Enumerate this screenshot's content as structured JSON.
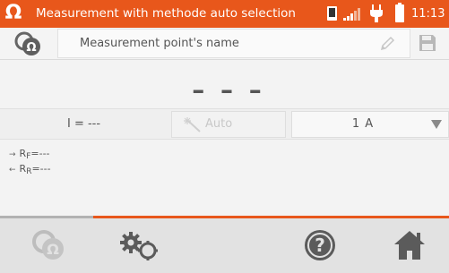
{
  "status_bar": {
    "omega_symbol": "Ω",
    "title": "Measurement with methode auto selection",
    "time": "11:13",
    "icons": [
      "omega-icon",
      "sd-card-icon",
      "signal-icon",
      "plug-icon",
      "battery-icon"
    ]
  },
  "point": {
    "name_placeholder": "Measurement point's name",
    "icons": [
      "measurement-icon",
      "pencil-icon",
      "save-icon"
    ]
  },
  "result": {
    "main_value": "– – –"
  },
  "params": {
    "current": "I = ---",
    "mode_label": "Auto",
    "range_value": "1 A"
  },
  "sub_results": {
    "forward_prefix": "R",
    "forward_sub": "F",
    "forward_value": "=---",
    "reverse_prefix": "R",
    "reverse_sub": "R",
    "reverse_value": "=---"
  },
  "toolbar": {
    "items": [
      "measurement-icon",
      "settings-gears-icon",
      "help-icon",
      "home-icon"
    ]
  },
  "colors": {
    "accent": "#e8571b",
    "background": "#f3f3f3",
    "toolbar": "#e2e2e2"
  }
}
